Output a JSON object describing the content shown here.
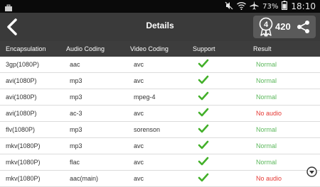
{
  "status_bar": {
    "battery": "73%",
    "time": "18:10",
    "icons": [
      "briefcase-icon",
      "mute-icon",
      "wifi-icon",
      "airplane-icon",
      "battery-icon"
    ]
  },
  "app_bar": {
    "title": "Details",
    "score": "420",
    "score_icon": "4",
    "back_icon": "back-chevron-icon",
    "share_icon": "share-icon"
  },
  "table": {
    "headers": [
      "Encapsulation",
      "Audio Coding",
      "Video Coding",
      "Support",
      "Result"
    ],
    "rows": [
      {
        "encapsulation": "3gp(1080P)",
        "audio": "aac",
        "video": "avc",
        "support": true,
        "result": "Normal"
      },
      {
        "encapsulation": "avi(1080P)",
        "audio": "mp3",
        "video": "avc",
        "support": true,
        "result": "Normal"
      },
      {
        "encapsulation": "avi(1080P)",
        "audio": "mp3",
        "video": "mpeg-4",
        "support": true,
        "result": "Normal"
      },
      {
        "encapsulation": "avi(1080P)",
        "audio": "ac-3",
        "video": "avc",
        "support": true,
        "result": "No audio"
      },
      {
        "encapsulation": "flv(1080P)",
        "audio": "mp3",
        "video": "sorenson",
        "support": true,
        "result": "Normal"
      },
      {
        "encapsulation": "mkv(1080P)",
        "audio": "mp3",
        "video": "avc",
        "support": true,
        "result": "Normal"
      },
      {
        "encapsulation": "mkv(1080P)",
        "audio": "flac",
        "video": "avc",
        "support": true,
        "result": "Normal"
      },
      {
        "encapsulation": "mkv(1080P)",
        "audio": "aac(main)",
        "video": "avc",
        "support": true,
        "result": "No audio"
      }
    ]
  },
  "colors": {
    "status_bar": "#0a0a0a",
    "app_bar": "#3a3a3a",
    "header": "#3d3d3d",
    "check": "#43b02a",
    "normal": "#5cb85c",
    "no_audio": "#e53935"
  }
}
